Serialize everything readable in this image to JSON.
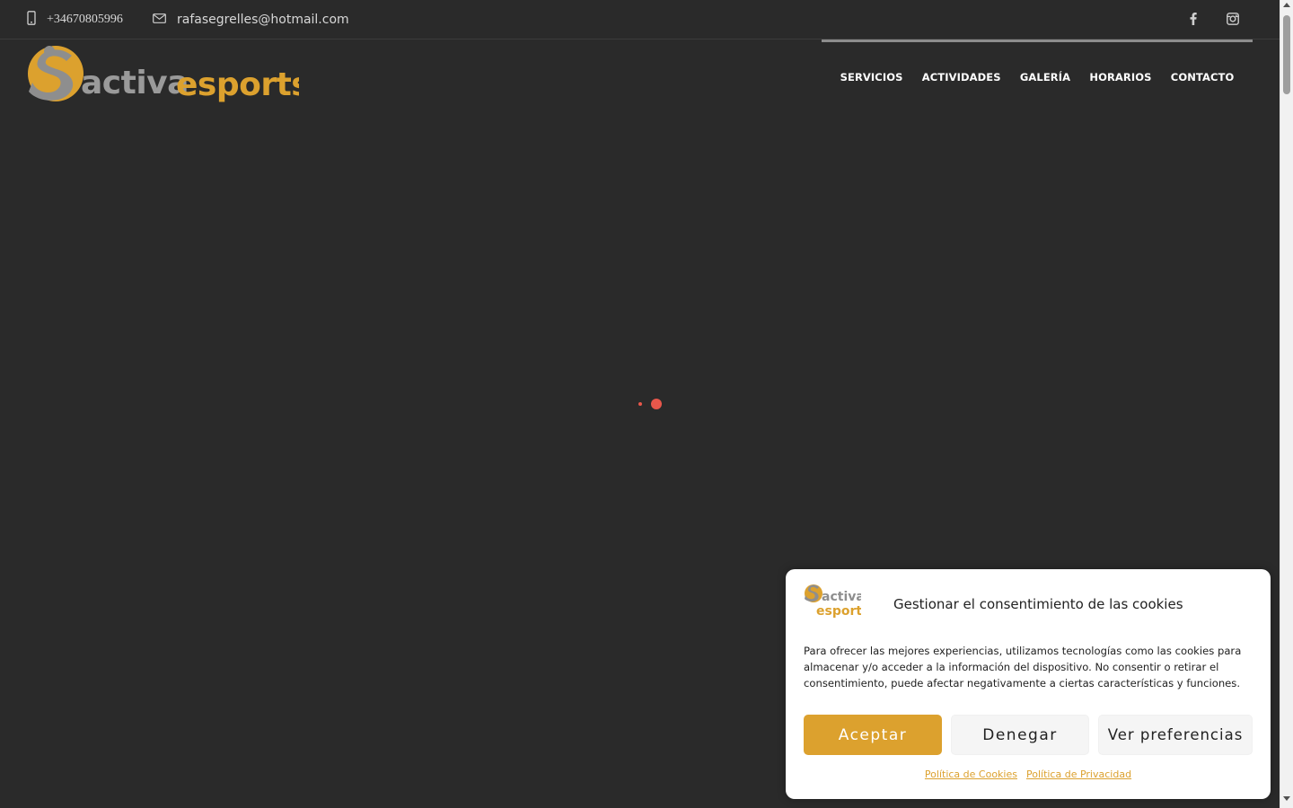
{
  "topbar": {
    "phone": "+34670805996",
    "email": "rafasegrelles@hotmail.com",
    "phone_icon": "mobile-phone-icon",
    "email_icon": "envelope-icon",
    "social": [
      "facebook-icon",
      "instagram-icon"
    ]
  },
  "logo": {
    "word_1": "activa",
    "word_2": "esports",
    "colors": {
      "orange": "#dca12e",
      "gray": "#9a9a9a"
    }
  },
  "nav": {
    "items": [
      "SERVICIOS",
      "ACTIVIDADES",
      "GALERÍA",
      "HORARIOS",
      "CONTACTO"
    ]
  },
  "loader": {
    "color": "#e8574b"
  },
  "cookie": {
    "logo_word_1": "activa",
    "logo_word_2": "esports",
    "title": "Gestionar el consentimiento de las cookies",
    "text": "Para ofrecer las mejores experiencias, utilizamos tecnologías como las cookies para almacenar y/o acceder a la información del dispositivo. No consentir o retirar el consentimiento, puede afectar negativamente a ciertas características y funciones.",
    "accept_label": "Aceptar",
    "deny_label": "Denegar",
    "prefs_label": "Ver preferencias",
    "link_cookies": "Política de Cookies",
    "link_privacy": "Política de Privacidad",
    "accent_color": "#dca12e"
  },
  "colors": {
    "background": "#2a2a2a",
    "accent": "#dca12e"
  }
}
